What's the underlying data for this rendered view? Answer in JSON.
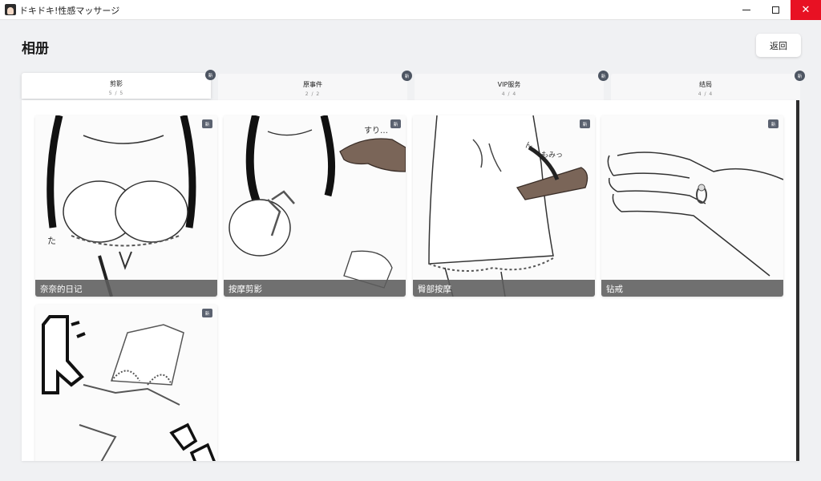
{
  "window": {
    "title": "ドキドキ!性感マッサージ",
    "minimize_glyph": "",
    "maximize_glyph": "",
    "close_glyph": "✕"
  },
  "page": {
    "title": "相册",
    "back_label": "返回"
  },
  "tabs": [
    {
      "label": "剪影",
      "count": "5 / 5",
      "badge": "新",
      "active": true
    },
    {
      "label": "原事件",
      "count": "2 / 2",
      "badge": "新",
      "active": false
    },
    {
      "label": "VIP服务",
      "count": "4 / 4",
      "badge": "新",
      "active": false
    },
    {
      "label": "结局",
      "count": "4 / 4",
      "badge": "新",
      "active": false
    }
  ],
  "gallery": {
    "items": [
      {
        "caption": "奈奈的日记",
        "badge": "新"
      },
      {
        "caption": "按摩剪影",
        "badge": "新"
      },
      {
        "caption": "臀部按摩",
        "badge": "新"
      },
      {
        "caption": "钻戒",
        "badge": "新"
      },
      {
        "caption": "",
        "badge": "新"
      }
    ]
  },
  "colors": {
    "close_button": "#e81123",
    "badge": "#4d5562",
    "caption_bar": "#5c5c5c",
    "scrollbar": "#2e2e2e"
  }
}
